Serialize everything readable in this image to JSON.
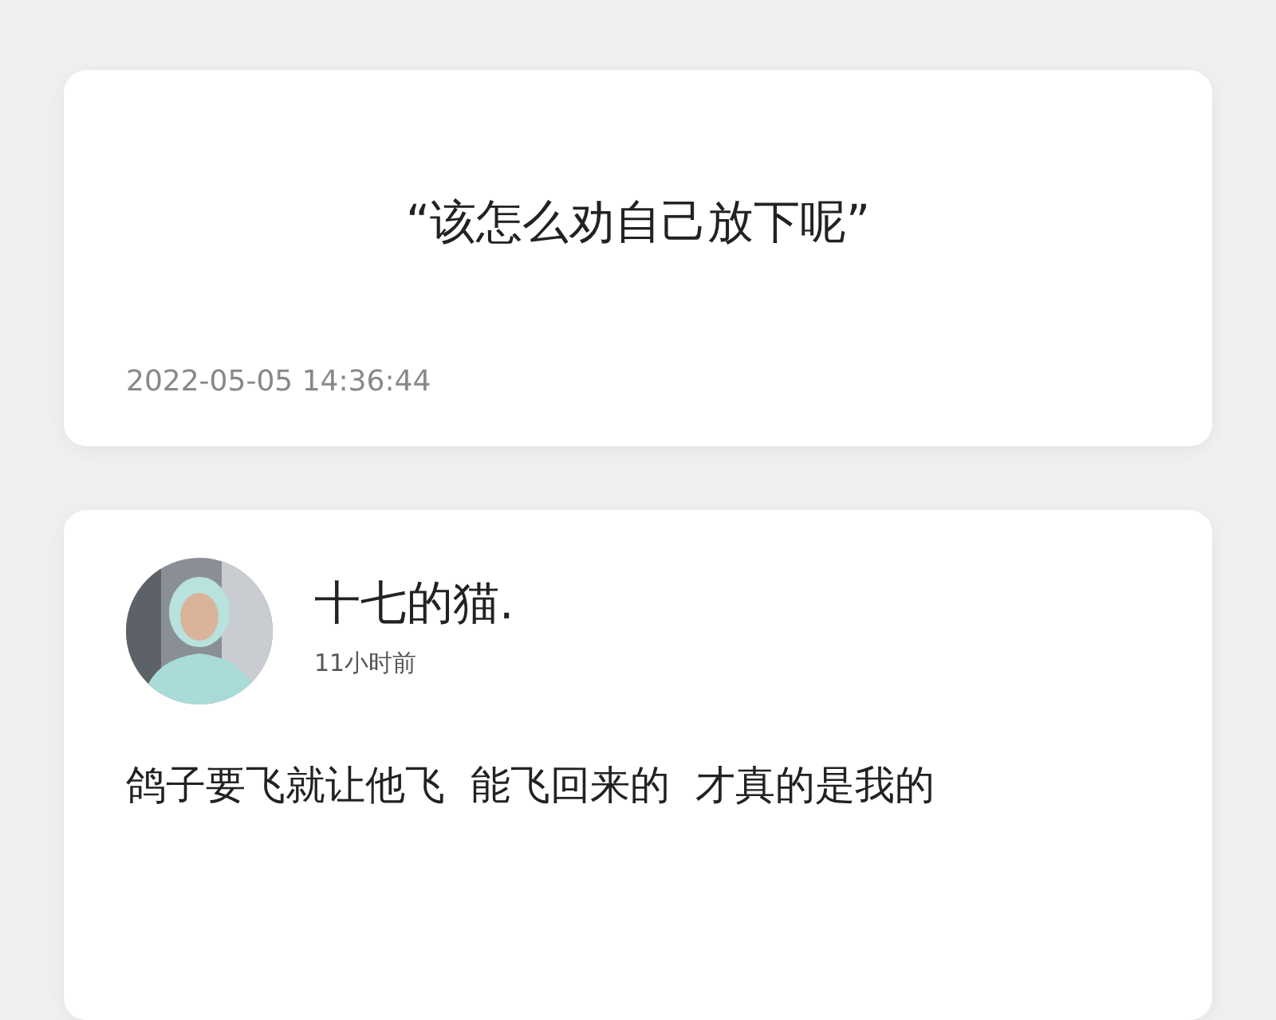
{
  "quote_card": {
    "quote": "“该怎么劝自己放下呢”",
    "timestamp": "2022-05-05 14:36:44"
  },
  "post_card": {
    "author": "十七的猫.",
    "time": "11小时前",
    "text": "鸽子要飞就让他飞  能飞回来的  才真的是我的"
  }
}
